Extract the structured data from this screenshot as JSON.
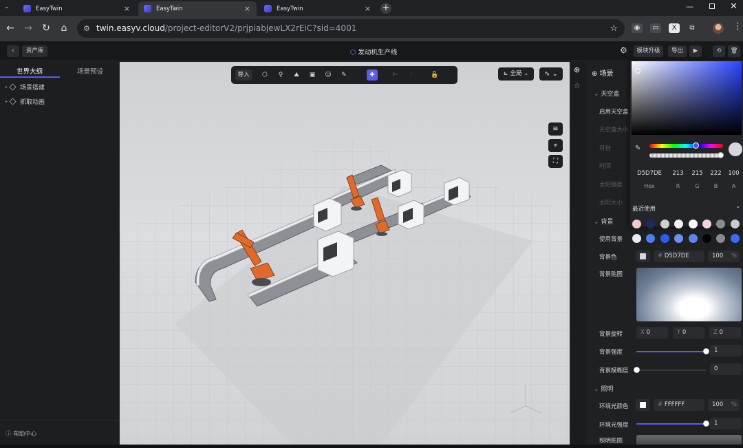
{
  "browser": {
    "tabs": [
      {
        "title": "EasyTwin",
        "active": false
      },
      {
        "title": "EasyTwin",
        "active": true
      },
      {
        "title": "EasyTwin",
        "active": false
      }
    ],
    "url_host": "twin.easyv.cloud",
    "url_path": "/project-editorV2/prjpiabjewLX2rEiC?sid=4001"
  },
  "header": {
    "back_label": "资产库",
    "project_title": "发动机生产线",
    "upgrade_label": "模块升级",
    "export_label": "导出"
  },
  "left_panel": {
    "tabs": [
      "世界大纲",
      "场景预设"
    ],
    "tree": [
      {
        "label": "场景搭建"
      },
      {
        "label": "抓取动画"
      }
    ],
    "help_label": "帮助中心"
  },
  "viewport": {
    "toolbar": {
      "import_label": "导入"
    },
    "view_mode_label": "全局"
  },
  "right_panel": {
    "title": "场景",
    "skybox": {
      "section": "天空盒",
      "enable_label": "启用天空盒",
      "skybox_size_label": "天空盒大小",
      "month_label": "月份",
      "time_label": "时间",
      "sun_intensity_label": "太阳强度",
      "sun_size_label": "太阳大小"
    },
    "background": {
      "section": "背景",
      "use_bg_label": "使用背景",
      "bg_color_label": "背景色",
      "bg_color_hex": "D5D7DE",
      "bg_color_opacity": "100",
      "percent_unit": "%",
      "bg_map_label": "背景贴图",
      "bg_rotation_label": "背景旋转",
      "rot_x_label": "X",
      "rot_x": "0",
      "rot_y_label": "Y",
      "rot_y": "0",
      "rot_z_label": "Z",
      "rot_z": "0",
      "bg_intensity_label": "背景强度",
      "bg_intensity": "1",
      "bg_intensity_level": 1.0,
      "bg_blur_label": "背景模糊度",
      "bg_blur": "0",
      "bg_blur_level": 0.0
    },
    "lighting": {
      "section": "照明",
      "ambient_color_label": "环境光颜色",
      "ambient_color_hex": "FFFFFF",
      "ambient_opacity": "100",
      "ambient_intensity_label": "环境光强度",
      "ambient_intensity": "1",
      "ambient_intensity_level": 1.0,
      "light_map_label": "照明贴图"
    }
  },
  "color_picker": {
    "hex": "D5D7DE",
    "r": "213",
    "g": "215",
    "b": "222",
    "a": "100",
    "labels": {
      "hex": "Hex",
      "r": "R",
      "g": "G",
      "b": "B",
      "a": "A"
    },
    "recent_label": "最近使用",
    "recent_colors": [
      "#f4c7d1",
      "#1d2a5e",
      "#cfcfcf",
      "#f2f2f2",
      "#f7f7f7",
      "#f3d3dc",
      "#8a8c92",
      "#c9cacd",
      "#e9ecf5",
      "#4d7ef0",
      "#2a5cf2",
      "#6b8ff2",
      "#5b86f0",
      "#050505",
      "#8a8b8f",
      "#3b6cf0"
    ]
  },
  "colors": {
    "accent": "#5b5bf0",
    "robot_orange": "#e06a2c"
  },
  "icons": [
    "back-arrow-icon",
    "reload-icon",
    "home-icon",
    "star-icon",
    "extensions-icon",
    "globe-icon",
    "gear-icon",
    "play-icon",
    "layers-icon",
    "focus-icon",
    "fullscreen-icon",
    "eyedropper-icon",
    "help-icon"
  ]
}
